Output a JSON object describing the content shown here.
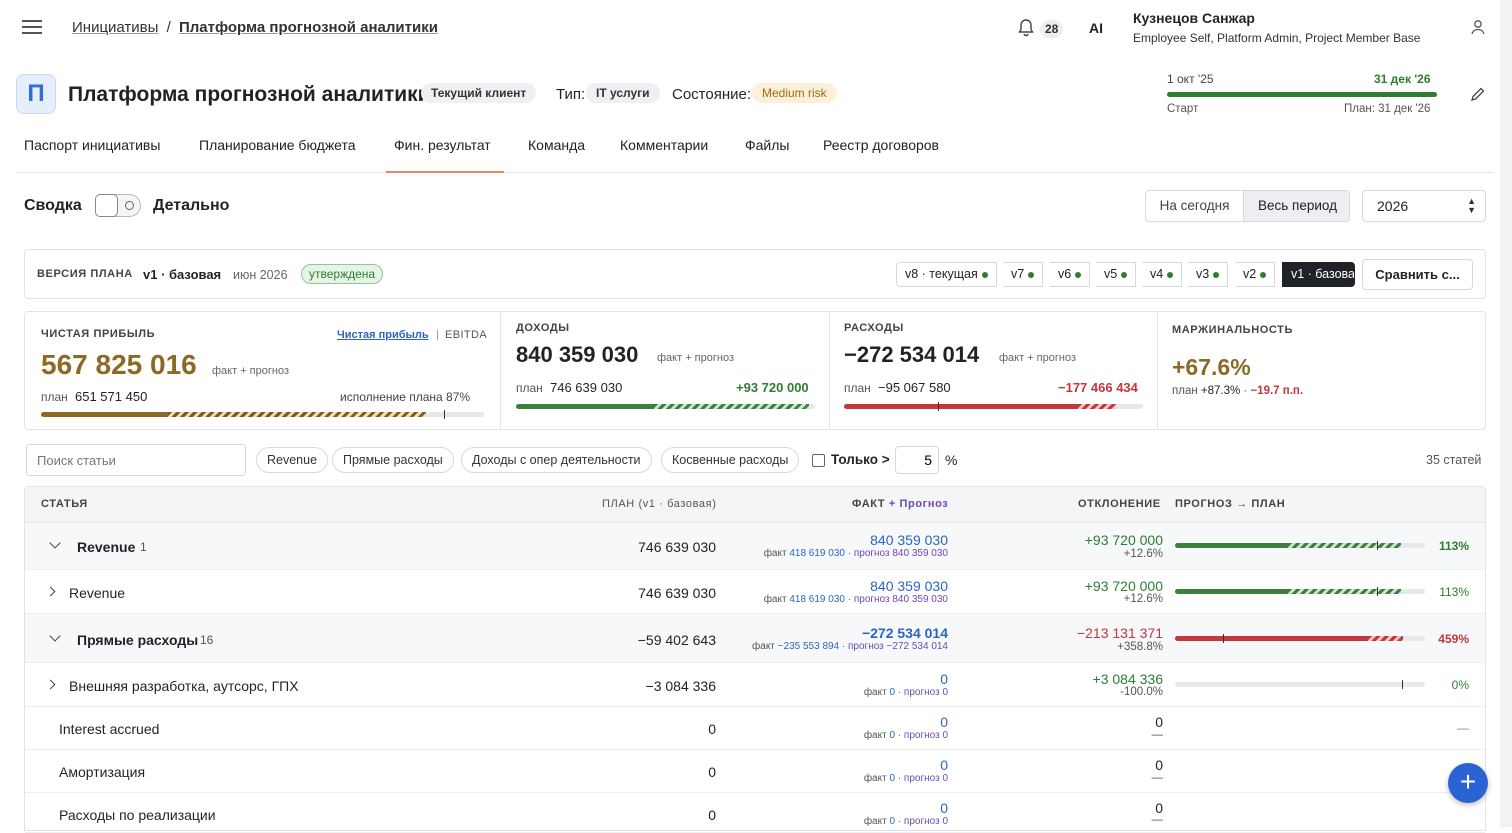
{
  "breadcrumb": {
    "parent": "Инициативы",
    "sep": "/",
    "current": "Платформа прогнозной аналитики"
  },
  "header": {
    "notifications": "28",
    "ai": "AI",
    "user_name": "Кузнецов Санжар",
    "user_roles": "Employee Self, Platform Admin, Project Member Base"
  },
  "project": {
    "logo": "П",
    "title": "Платформа прогнозной аналитики",
    "client_badge": "Текущий клиент",
    "type_label": "Тип:",
    "type_value": "IT услуги",
    "state_label": "Состояние:",
    "state_value": "Medium risk",
    "start_date": "1 окт '25",
    "end_date": "31 дек '26",
    "start_label": "Старт",
    "plan_label": "План: 31 дек '26",
    "timeline_progress": 1.0
  },
  "tabs": [
    "Паспорт инициативы",
    "Планирование бюджета",
    "Фин. результат",
    "Команда",
    "Комментарии",
    "Файлы",
    "Реестр договоров"
  ],
  "view": {
    "summary": "Сводка",
    "detailed": "Детально",
    "today": "На сегодня",
    "all_period": "Весь период",
    "year": "2026"
  },
  "version": {
    "label": "ВЕРСИЯ ПЛАНА",
    "name": "v1 · базовая",
    "date": "июн 2026",
    "status": "утверждена",
    "chips": [
      "v8 · текущая",
      "v7",
      "v6",
      "v5",
      "v4",
      "v3",
      "v2",
      "v1 · базова"
    ],
    "compare": "Сравнить с..."
  },
  "kpi": {
    "profit": {
      "label": "ЧИСТАЯ ПРИБЫЛЬ",
      "switch_a": "Чистая прибыль",
      "switch_sep": "|",
      "switch_b": "EBITDA",
      "value": "567 825 016",
      "suffix": "факт + прогноз",
      "plan_label": "план",
      "plan_value": "651 571 450",
      "exec_label": "исполнение плана 87%",
      "progress": 0.87
    },
    "income": {
      "label": "ДОХОДЫ",
      "value": "840 359 030",
      "suffix": "факт + прогноз",
      "plan_label": "план",
      "plan_value": "746 639 030",
      "delta": "+93 720 000",
      "progress": 0.98
    },
    "expense": {
      "label": "РАСХОДЫ",
      "value": "−272 534 014",
      "suffix": "факт + прогноз",
      "plan_label": "план",
      "plan_value": "−95 067 580",
      "delta": "−177 466 434",
      "progress": 0.91
    },
    "margin": {
      "label": "МАРЖИНАЛЬНОСТЬ",
      "value": "+67.6%",
      "plan_label": "план",
      "plan_value": "+87.3%",
      "sep": "·",
      "delta": "−19.7 п.п."
    }
  },
  "filters": {
    "search_placeholder": "Поиск статьи",
    "chips": [
      "Revenue",
      "Прямые расходы",
      "Доходы с опер деятельности",
      "Косвенные расходы"
    ],
    "only_label": "Только >",
    "threshold": "5",
    "pct": "%",
    "count": "35 статей"
  },
  "table": {
    "headers": {
      "item": "СТАТЬЯ",
      "plan": "ПЛАН (v1 · базовая)",
      "fact": "ФАКТ",
      "forecast": "+ Прогноз",
      "deviation": "ОТКЛОНЕНИЕ",
      "progress": "ПРОГНОЗ → ПЛАН"
    },
    "rows": [
      {
        "name": "Revenue",
        "count": "1",
        "plan": "746 639 030",
        "fact_total": "840 359 030",
        "fact_lbl": "факт",
        "fact_val": "418 619 030",
        "fc_lbl": "· прогноз",
        "fc_val": "840 359 030",
        "dev": "+93 720 000",
        "dev_pct": "+12.6%",
        "pct": "113%",
        "progress": 1.13
      },
      {
        "name": "Revenue",
        "count": "",
        "plan": "746 639 030",
        "fact_total": "840 359 030",
        "fact_lbl": "факт",
        "fact_val": "418 619 030",
        "fc_lbl": "· прогноз",
        "fc_val": "840 359 030",
        "dev": "+93 720 000",
        "dev_pct": "+12.6%",
        "pct": "113%",
        "progress": 1.13
      },
      {
        "name": "Прямые расходы",
        "count": "16",
        "plan": "−59 402 643",
        "fact_total": "−272 534 014",
        "fact_lbl": "факт",
        "fact_val": "−235 553 894",
        "fc_lbl": "· прогноз",
        "fc_val": "−272 534 014",
        "dev": "−213 131 371",
        "dev_pct": "+358.8%",
        "pct": "459%",
        "progress": 4.59
      },
      {
        "name": "Внешняя разработка, аутсорс, ГПХ",
        "count": "",
        "plan": "−3 084 336",
        "fact_total": "0",
        "fact_lbl": "факт",
        "fact_val": "0",
        "fc_lbl": "· прогноз",
        "fc_val": "0",
        "dev": "+3 084 336",
        "dev_pct": "-100.0%",
        "pct": "0%",
        "progress": 0
      },
      {
        "name": "Interest accrued",
        "count": "",
        "plan": "0",
        "fact_total": "0",
        "fact_lbl": "факт",
        "fact_val": "0",
        "fc_lbl": "· прогноз",
        "fc_val": "0",
        "dev": "0",
        "dev_pct": "—",
        "pct": "—"
      },
      {
        "name": "Амортизация",
        "count": "",
        "plan": "0",
        "fact_total": "0",
        "fact_lbl": "факт",
        "fact_val": "0",
        "fc_lbl": "· прогноз",
        "fc_val": "0",
        "dev": "0",
        "dev_pct": "—",
        "pct": ""
      },
      {
        "name": "Расходы по реализации",
        "count": "",
        "plan": "0",
        "fact_total": "0",
        "fact_lbl": "факт",
        "fact_val": "0",
        "fc_lbl": "· прогноз",
        "fc_val": "0",
        "dev": "0",
        "dev_pct": "—",
        "pct": ""
      }
    ]
  },
  "fab": "+",
  "colors": {
    "accent": "#2a63d4",
    "green": "#2e7d32",
    "red": "#c4363a",
    "gold": "#8a6a25",
    "tab_underline": "#e48b6a"
  }
}
